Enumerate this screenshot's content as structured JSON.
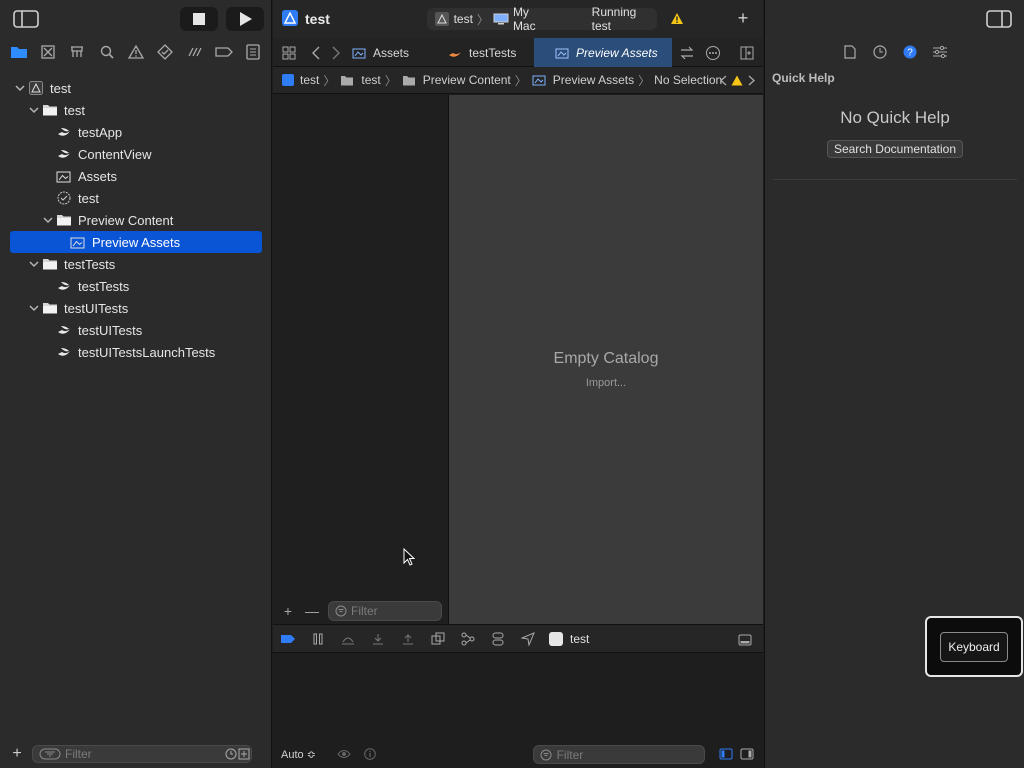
{
  "toolbar": {
    "project_name": "test",
    "scheme": "test",
    "destination": "My Mac",
    "status": "Running test"
  },
  "navigator": {
    "tree": [
      {
        "label": "test",
        "type": "project",
        "level": 0,
        "expanded": true
      },
      {
        "label": "test",
        "type": "folder",
        "level": 1,
        "expanded": true
      },
      {
        "label": "testApp",
        "type": "swift",
        "level": 2
      },
      {
        "label": "ContentView",
        "type": "swift",
        "level": 2
      },
      {
        "label": "Assets",
        "type": "assets",
        "level": 2
      },
      {
        "label": "test",
        "type": "entitlements",
        "level": 2
      },
      {
        "label": "Preview Content",
        "type": "folder",
        "level": 2,
        "expanded": true
      },
      {
        "label": "Preview Assets",
        "type": "assets",
        "level": 3,
        "selected": true
      },
      {
        "label": "testTests",
        "type": "folder",
        "level": 1,
        "expanded": true
      },
      {
        "label": "testTests",
        "type": "swift",
        "level": 2
      },
      {
        "label": "testUITests",
        "type": "folder",
        "level": 1,
        "expanded": true
      },
      {
        "label": "testUITests",
        "type": "swift",
        "level": 2
      },
      {
        "label": "testUITestsLaunchTests",
        "type": "swift",
        "level": 2
      }
    ],
    "filter_placeholder": "Filter"
  },
  "tabs": [
    {
      "label": "Assets",
      "icon": "assets-icon"
    },
    {
      "label": "testTests",
      "icon": "swift-icon"
    },
    {
      "label": "Preview Assets",
      "icon": "assets-icon",
      "active": true
    }
  ],
  "jumpbar": {
    "crumbs": [
      "test",
      "test",
      "Preview Content",
      "Preview Assets",
      "No Selection"
    ]
  },
  "asset_catalog": {
    "empty_title": "Empty Catalog",
    "import_label": "Import...",
    "filter_placeholder": "Filter"
  },
  "debug": {
    "process": "test"
  },
  "console": {
    "mode": "Auto ≎",
    "filter_placeholder": "Filter"
  },
  "inspector": {
    "section_title": "Quick Help",
    "no_help": "No Quick Help",
    "search_button": "Search Documentation"
  },
  "keyboard_popup": {
    "label": "Keyboard"
  },
  "colors": {
    "accent": "#0a55d6",
    "warning": "#f5c518",
    "swift": "#f0883e"
  }
}
